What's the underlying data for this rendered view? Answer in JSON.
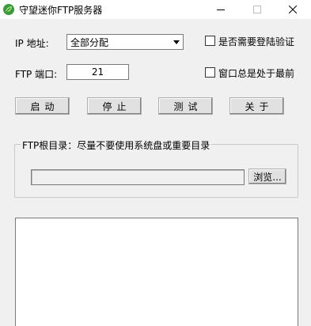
{
  "window": {
    "title": "守望迷你FTP服务器",
    "icon": "green-leaf-app-icon",
    "controls": [
      "minimize-icon",
      "maximize-icon",
      "close-icon"
    ]
  },
  "ip": {
    "label": "IP 地址:",
    "selected": "全部分配"
  },
  "port": {
    "label": "FTP 端口:",
    "value": "21"
  },
  "options": {
    "require_login": "是否需要登陆验证",
    "always_on_top": "窗口总是处于最前"
  },
  "buttons": {
    "start": "启动",
    "stop": "停止",
    "test": "测试",
    "about": "关于"
  },
  "root_dir": {
    "group_title": "FTP根目录：尽量不要使用系统盘或重要目录",
    "path": "",
    "browse": "浏览..."
  },
  "log": {
    "content": ""
  }
}
